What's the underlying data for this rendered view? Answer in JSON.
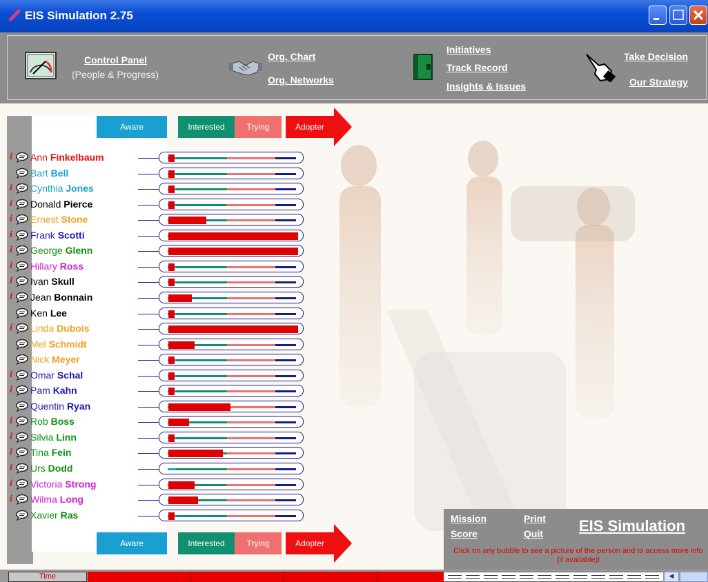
{
  "window": {
    "title": "EIS Simulation 2.75"
  },
  "toolbar": {
    "control_panel": "Control Panel",
    "control_panel_sub": "(People & Progress)",
    "org_chart": "Org. Chart",
    "org_networks": "Org. Networks",
    "initiatives": "Initiatives",
    "track_record": "Track Record",
    "insights": "Insights & Issues",
    "take_decision": "Take Decision",
    "our_strategy": "Our Strategy",
    "icons": [
      "gauge-icon",
      "handshake-icon",
      "binder-icon",
      "pointing-hand-icon"
    ]
  },
  "stages": [
    "Aware",
    "Interested",
    "Trying",
    "Adopter"
  ],
  "stage_colors": {
    "aware": "#1aa0d0",
    "interested": "#109070",
    "trying": "#f07070",
    "adopter": "#ee1010"
  },
  "people": [
    {
      "first": "Ann",
      "last": "Finkelbaum",
      "color": "#e01010",
      "info": true,
      "progress": 0.05
    },
    {
      "first": "Bart",
      "last": "Bell",
      "color": "#1aa0d0",
      "info": false,
      "progress": 0.05
    },
    {
      "first": "Cynthia",
      "last": "Jones",
      "color": "#1aa0d0",
      "info": true,
      "progress": 0.05
    },
    {
      "first": "Donald",
      "last": "Pierce",
      "color": "#000000",
      "info": true,
      "progress": 0.05
    },
    {
      "first": "Ernest",
      "last": "Stone",
      "color": "#f0a020",
      "info": true,
      "progress": 0.29
    },
    {
      "first": "Frank",
      "last": "Scotti",
      "color": "#1a1ab0",
      "info": true,
      "progress": 1.0
    },
    {
      "first": "George",
      "last": "Glenn",
      "color": "#109010",
      "info": true,
      "progress": 1.0
    },
    {
      "first": "Hillary",
      "last": "Ross",
      "color": "#d020d0",
      "info": true,
      "progress": 0.05
    },
    {
      "first": "Ivan",
      "last": "Skull",
      "color": "#000000",
      "info": true,
      "progress": 0.05
    },
    {
      "first": "Jean",
      "last": "Bonnain",
      "color": "#000000",
      "info": true,
      "progress": 0.18
    },
    {
      "first": "Ken",
      "last": "Lee",
      "color": "#000000",
      "info": false,
      "progress": 0.05
    },
    {
      "first": "Linda",
      "last": "Dubois",
      "color": "#f0a020",
      "info": true,
      "progress": 1.0
    },
    {
      "first": "Mel",
      "last": "Schmidt",
      "color": "#f0a020",
      "info": false,
      "progress": 0.2
    },
    {
      "first": "Nick",
      "last": "Meyer",
      "color": "#f0a020",
      "info": false,
      "progress": 0.05
    },
    {
      "first": "Omar",
      "last": "Schal",
      "color": "#1a1ab0",
      "info": true,
      "progress": 0.05
    },
    {
      "first": "Pam",
      "last": "Kahn",
      "color": "#1a1ab0",
      "info": true,
      "progress": 0.05
    },
    {
      "first": "Quentin",
      "last": "Ryan",
      "color": "#1a1ab0",
      "info": false,
      "progress": 0.48
    },
    {
      "first": "Rob",
      "last": "Boss",
      "color": "#109010",
      "info": true,
      "progress": 0.16
    },
    {
      "first": "Silvia",
      "last": "Linn",
      "color": "#109010",
      "info": true,
      "progress": 0.05
    },
    {
      "first": "Tina",
      "last": "Fein",
      "color": "#109010",
      "info": true,
      "progress": 0.42
    },
    {
      "first": "Urs",
      "last": "Dodd",
      "color": "#109010",
      "info": true,
      "progress": 0.0
    },
    {
      "first": "Victoria",
      "last": "Strong",
      "color": "#d020d0",
      "info": true,
      "progress": 0.2
    },
    {
      "first": "Wilma",
      "last": "Long",
      "color": "#d020d0",
      "info": true,
      "progress": 0.23
    },
    {
      "first": "Xavier",
      "last": "Ras",
      "color": "#109010",
      "info": false,
      "progress": 0.05
    }
  ],
  "bottom_panel": {
    "mission": "Mission",
    "score": "Score",
    "print": "Print",
    "quit": "Quit",
    "title": "EIS Simulation",
    "hint": "Click on any bubble to see a picture of the person and to access more info (if available)!"
  },
  "status": {
    "time_label": "Time",
    "time_progress": 1.0
  }
}
